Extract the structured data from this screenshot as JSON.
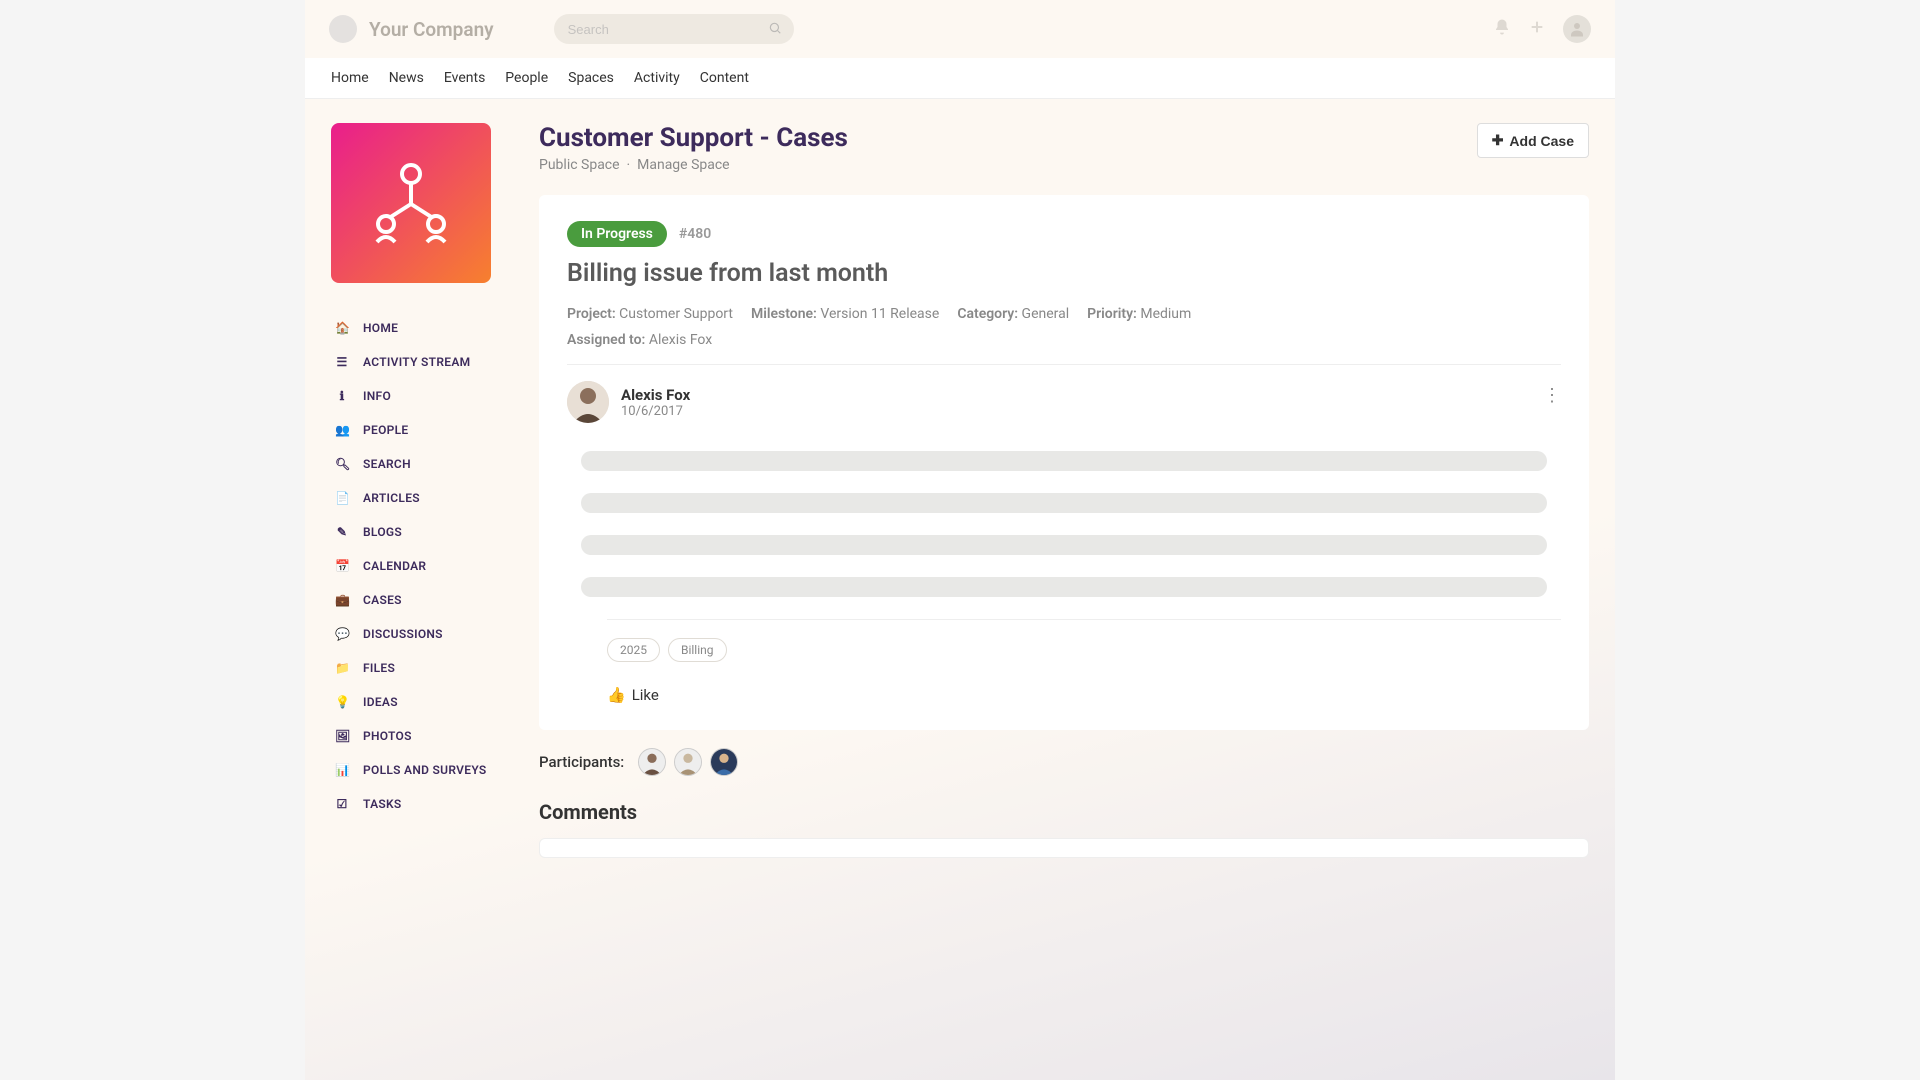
{
  "header": {
    "company": "Your Company",
    "search_placeholder": "Search"
  },
  "nav": {
    "items": [
      "Home",
      "News",
      "Events",
      "People",
      "Spaces",
      "Activity",
      "Content"
    ]
  },
  "sidebar": {
    "items": [
      {
        "icon": "home",
        "label": "HOME"
      },
      {
        "icon": "list",
        "label": "ACTIVITY STREAM"
      },
      {
        "icon": "info",
        "label": "INFO"
      },
      {
        "icon": "people",
        "label": "PEOPLE"
      },
      {
        "icon": "search",
        "label": "SEARCH"
      },
      {
        "icon": "article",
        "label": "ARTICLES"
      },
      {
        "icon": "blog",
        "label": "BLOGS"
      },
      {
        "icon": "calendar",
        "label": "CALENDAR"
      },
      {
        "icon": "case",
        "label": "CASES"
      },
      {
        "icon": "discussion",
        "label": "DISCUSSIONS"
      },
      {
        "icon": "files",
        "label": "FILES"
      },
      {
        "icon": "idea",
        "label": "IDEAS"
      },
      {
        "icon": "photos",
        "label": "PHOTOS"
      },
      {
        "icon": "polls",
        "label": "POLLS AND SURVEYS"
      },
      {
        "icon": "tasks",
        "label": "TASKS"
      }
    ]
  },
  "page": {
    "title": "Customer Support - Cases",
    "space_type": "Public Space",
    "manage_link": "Manage Space",
    "add_case": "Add Case"
  },
  "case": {
    "status": "In Progress",
    "id": "#480",
    "title": "Billing issue from last month",
    "project_label": "Project:",
    "project_value": "Customer Support",
    "milestone_label": "Milestone:",
    "milestone_value": "Version 11 Release",
    "category_label": "Category:",
    "category_value": "General",
    "priority_label": "Priority:",
    "priority_value": "Medium",
    "assigned_label": "Assigned to:",
    "assigned_value": "Alexis Fox",
    "author_name": "Alexis Fox",
    "author_date": "10/6/2017",
    "tags": [
      "2025",
      "Billing"
    ],
    "like_label": "Like"
  },
  "participants": {
    "label": "Participants:"
  },
  "comments": {
    "title": "Comments"
  }
}
